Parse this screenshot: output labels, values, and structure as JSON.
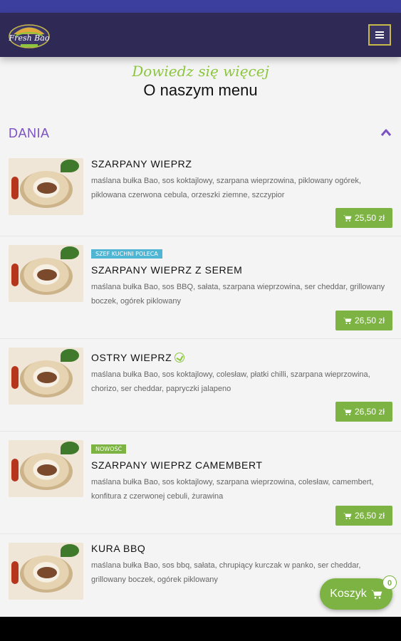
{
  "header": {
    "logo_text": "Fresh Bao",
    "menu_icon": "hamburger-icon"
  },
  "hero": {
    "subtitle": "Dowiedz się więcej",
    "title": "O naszym menu"
  },
  "section": {
    "label": "DANIA",
    "toggle_icon": "chevron-up-icon"
  },
  "items": [
    {
      "name": "SZARPANY WIEPRZ",
      "badge": "",
      "description": "maślana bułka Bao, sos koktajlowy, szarpana wieprzowina, piklowany ogórek, piklowana czerwona cebula, orzeszki ziemne, szczypior",
      "price": "25,50 zł"
    },
    {
      "name": "SZARPANY WIEPRZ Z SEREM",
      "badge": "SZEF KUCHNI POLECA",
      "description": "maślana bułka Bao, sos BBQ, sałata, szarpana wieprzowina, ser cheddar, grillowany boczek, ogórek piklowany",
      "price": "26,50 zł"
    },
    {
      "name": "OSTRY WIEPRZ",
      "badge": "",
      "description": "maślana bułka Bao, sos koktajlowy, colesław, płatki chilli, szarpana wieprzowina, chorizo, ser cheddar, papryczki jalapeno",
      "price": "26,50 zł"
    },
    {
      "name": "SZARPANY WIEPRZ CAMEMBERT",
      "badge": "NOWOŚĆ",
      "description": "maślana bułka Bao, sos koktajlowy, szarpana wieprzowina, colesław, camembert, konfitura z czerwonej cebuli, żurawina",
      "price": "26,50 zł"
    },
    {
      "name": "KURA BBQ",
      "badge": "",
      "description": "maślana bułka Bao, sos bbq, sałata, chrupiący kurczak w panko, ser cheddar, grillowany boczek, ogórek piklowany",
      "price": ""
    }
  ],
  "cart": {
    "label": "Koszyk",
    "count": "0"
  },
  "colors": {
    "header_bg": "#2f2a55",
    "status_bar": "#3d3f9e",
    "accent_green": "#7cb342",
    "section_purple": "#7b52c2",
    "badge_blue": "#4fb5d3"
  }
}
